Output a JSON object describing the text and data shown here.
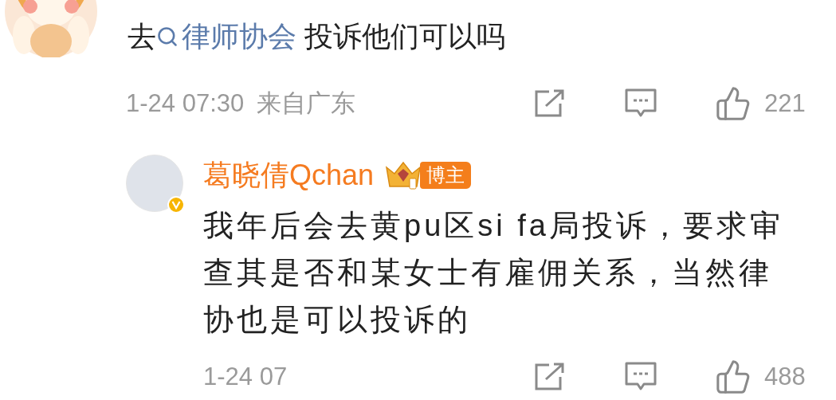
{
  "comment": {
    "text_parts": [
      {
        "kind": "plain",
        "text": "去"
      },
      {
        "kind": "topic",
        "text": "律师协会"
      },
      {
        "kind": "plain",
        "text": " 投诉他们可以吗"
      }
    ],
    "time": "1-24 07:30",
    "location": "来自广东",
    "likes": "221"
  },
  "reply": {
    "author": "葛晓倩Qchan",
    "verified": true,
    "badge": "博主",
    "text": "我年后会去黄pu区si fa局投诉，要求审查其是否和某女士有雇佣关系，当然律协也是可以投诉的",
    "time": "1-24 07",
    "likes": "488"
  }
}
